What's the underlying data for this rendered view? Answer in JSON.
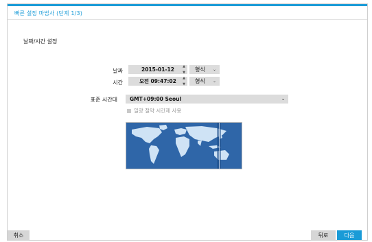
{
  "window": {
    "title": "빠른 설정 마법사 (단계 1/3)"
  },
  "section": {
    "title": "날짜/시간 설정"
  },
  "date": {
    "label": "날짜",
    "value": "2015-01-12",
    "format_label": "형식"
  },
  "time": {
    "label": "시간",
    "value": "오전 09:47:02",
    "format_label": "형식"
  },
  "timezone": {
    "label": "표준 시간대",
    "value": "GMT+09:00  Seoul"
  },
  "dst": {
    "label": "일광 절약 시간제 사용",
    "checked": false
  },
  "buttons": {
    "cancel": "취소",
    "back": "뒤로",
    "next": "다음"
  },
  "colors": {
    "accent": "#1a9bd7",
    "map_ocean": "#2f66a8",
    "map_land": "#cfe3f5",
    "field_bg": "#dcdcdc"
  }
}
